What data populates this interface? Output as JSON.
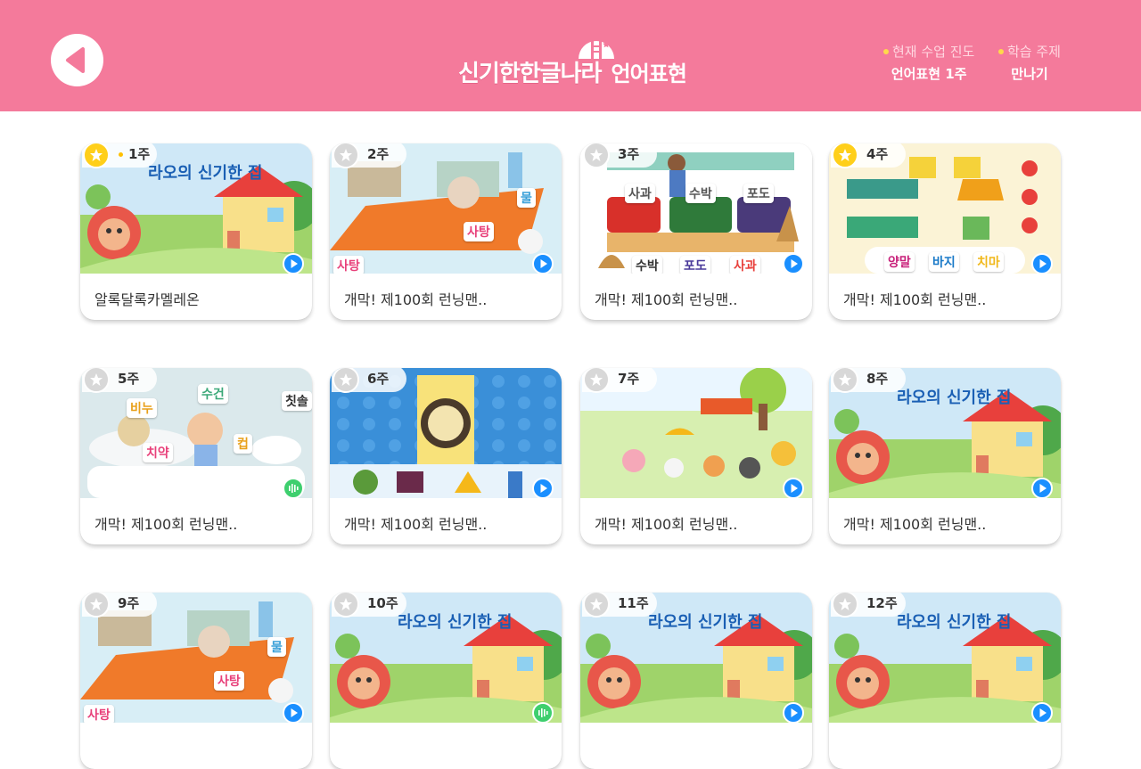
{
  "header": {
    "title_main": "신기한한글나라",
    "title_sub": "언어표현",
    "progress_label": "현재 수업 진도",
    "progress_value": "언어표현 1주",
    "topic_label": "학습 주제",
    "topic_value": "만나기"
  },
  "colors": {
    "header_bg": "#f47a9b",
    "play": "#1a8fff",
    "audio": "#3ecf6e",
    "star_on": "#ffcf1a",
    "star_off": "#d8d8d8"
  },
  "cards": [
    {
      "week": "1주",
      "title": "알록달록카멜레온",
      "starred": true,
      "current": true,
      "scene": "house",
      "action": "play-icon"
    },
    {
      "week": "2주",
      "title": "개막! 제100회 런닝맨..",
      "starred": false,
      "scene": "kitchen",
      "action": "play-icon",
      "words": [
        "물",
        "사탕",
        "사탕"
      ]
    },
    {
      "week": "3주",
      "title": "개막! 제100회 런닝맨..",
      "starred": false,
      "scene": "market",
      "action": "play-icon",
      "words": [
        "사과",
        "수박",
        "포도",
        "수박",
        "포도",
        "사과"
      ]
    },
    {
      "week": "4주",
      "title": "개막! 제100회 런닝맨..",
      "starred": true,
      "scene": "laundry",
      "action": "play-icon",
      "words": [
        "양말",
        "바지",
        "치마"
      ]
    },
    {
      "week": "5주",
      "title": "개막! 제100회 런닝맨..",
      "starred": false,
      "scene": "bath",
      "action": "audio-icon",
      "words": [
        "비누",
        "수건",
        "칫솔",
        "치약",
        "컵"
      ]
    },
    {
      "week": "6주",
      "title": "개막! 제100회 런닝맨..",
      "starred": false,
      "scene": "washer",
      "action": "play-icon"
    },
    {
      "week": "7주",
      "title": "개막! 제100회 런닝맨..",
      "starred": false,
      "scene": "park",
      "action": "play-icon"
    },
    {
      "week": "8주",
      "title": "개막! 제100회 런닝맨..",
      "starred": false,
      "scene": "house",
      "action": "play-icon"
    },
    {
      "week": "9주",
      "title": "",
      "starred": false,
      "scene": "kitchen",
      "action": "play-icon",
      "words": [
        "물",
        "사탕",
        "사탕"
      ]
    },
    {
      "week": "10주",
      "title": "",
      "starred": false,
      "scene": "house",
      "action": "audio-icon"
    },
    {
      "week": "11주",
      "title": "",
      "starred": false,
      "scene": "house",
      "action": "play-icon"
    },
    {
      "week": "12주",
      "title": "",
      "starred": false,
      "scene": "house",
      "action": "play-icon"
    }
  ],
  "scene_text": {
    "house_sign": "라오의 신기한 집"
  }
}
